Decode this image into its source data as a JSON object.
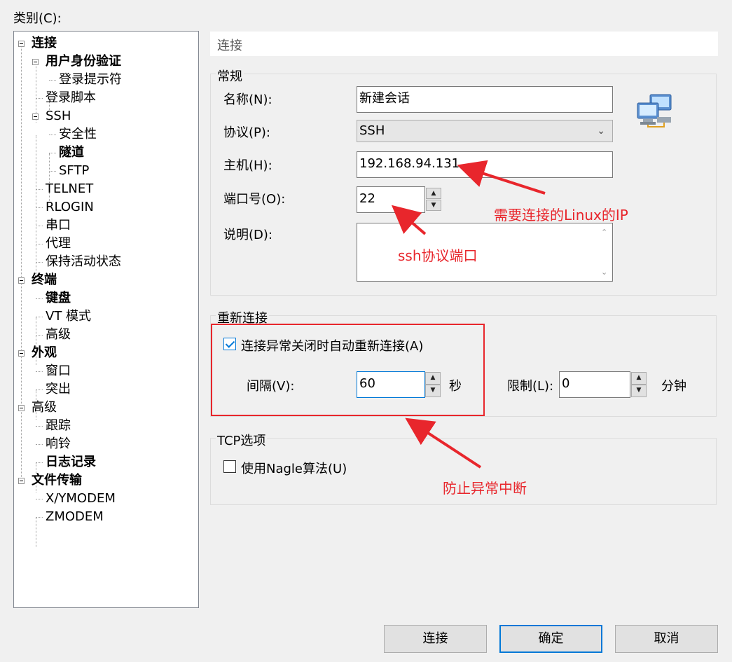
{
  "category_label": "类别(C):",
  "tree": {
    "items": [
      {
        "label": "连接",
        "bold": true,
        "expander": true
      },
      {
        "label": "用户身份验证",
        "bold": true,
        "expander": true
      },
      {
        "label": "登录提示符",
        "bold": false
      },
      {
        "label": "登录脚本",
        "bold": false
      },
      {
        "label": "SSH",
        "bold": false,
        "expander": true
      },
      {
        "label": "安全性",
        "bold": false
      },
      {
        "label": "隧道",
        "bold": true
      },
      {
        "label": "SFTP",
        "bold": false
      },
      {
        "label": "TELNET",
        "bold": false
      },
      {
        "label": "RLOGIN",
        "bold": false
      },
      {
        "label": "串口",
        "bold": false
      },
      {
        "label": "代理",
        "bold": false
      },
      {
        "label": "保持活动状态",
        "bold": false
      },
      {
        "label": "终端",
        "bold": true,
        "expander": true
      },
      {
        "label": "键盘",
        "bold": true
      },
      {
        "label": "VT 模式",
        "bold": false
      },
      {
        "label": "高级",
        "bold": false
      },
      {
        "label": "外观",
        "bold": true,
        "expander": true
      },
      {
        "label": "窗口",
        "bold": false
      },
      {
        "label": "突出",
        "bold": false
      },
      {
        "label": "高级",
        "bold": false,
        "expander": true
      },
      {
        "label": "跟踪",
        "bold": false
      },
      {
        "label": "响铃",
        "bold": false
      },
      {
        "label": "日志记录",
        "bold": true
      },
      {
        "label": "文件传输",
        "bold": true,
        "expander": true
      },
      {
        "label": "X/YMODEM",
        "bold": false
      },
      {
        "label": "ZMODEM",
        "bold": false
      }
    ]
  },
  "section_title": "连接",
  "general": {
    "title": "常规",
    "name_label": "名称(N):",
    "name_value": "新建会话",
    "protocol_label": "协议(P):",
    "protocol_value": "SSH",
    "host_label": "主机(H):",
    "host_value": "192.168.94.131",
    "port_label": "端口号(O):",
    "port_value": "22",
    "desc_label": "说明(D):",
    "desc_value": "",
    "icon": "network-computers-icon"
  },
  "reconnect": {
    "title": "重新连接",
    "auto_label": "连接异常关闭时自动重新连接(A)",
    "auto_checked": true,
    "interval_label": "间隔(V):",
    "interval_value": "60",
    "interval_unit": "秒",
    "limit_label": "限制(L):",
    "limit_value": "0",
    "limit_unit": "分钟"
  },
  "tcp": {
    "title": "TCP选项",
    "nagle_label": "使用Nagle算法(U)",
    "nagle_checked": false
  },
  "buttons": {
    "connect": "连接",
    "ok": "确定",
    "cancel": "取消"
  },
  "annotations": {
    "host_note": "需要连接的Linux的IP",
    "port_note": "ssh协议端口",
    "reconnect_note": "防止异常中断",
    "color": "#e8262c"
  }
}
